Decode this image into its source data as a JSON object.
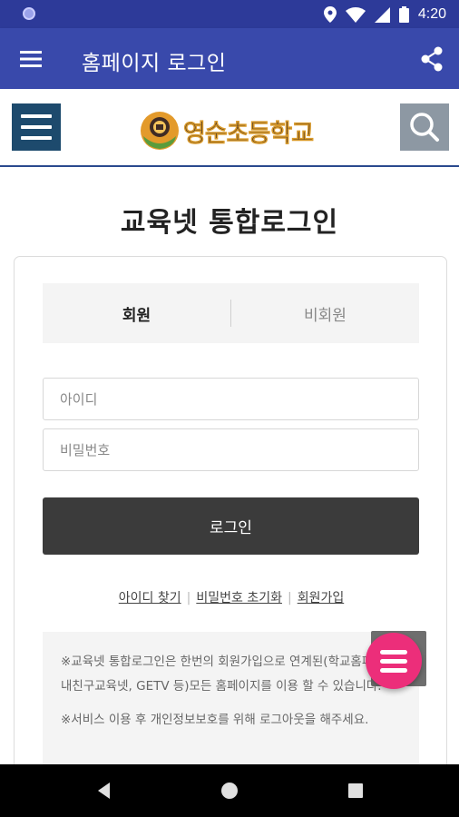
{
  "status_bar": {
    "time": "4:20",
    "icons": [
      "location-icon",
      "wifi-icon",
      "signal-icon",
      "battery-icon"
    ]
  },
  "app_bar": {
    "title": "홈페이지 로그인",
    "menu_icon": "hamburger-menu-icon",
    "share_icon": "share-icon",
    "color": "#3949ab"
  },
  "site_header": {
    "logo_text": "영순초등학교",
    "menu_icon": "hamburger-menu-icon",
    "search_icon": "search-icon"
  },
  "page": {
    "title": "교육넷 통합로그인"
  },
  "login": {
    "tabs": [
      {
        "label": "회원",
        "active": true
      },
      {
        "label": "비회원",
        "active": false
      }
    ],
    "id_placeholder": "아이디",
    "password_placeholder": "비밀번호",
    "submit_label": "로그인",
    "links": [
      {
        "label": "아이디 찾기"
      },
      {
        "label": "비밀번호 초기화"
      },
      {
        "label": "회원가입"
      }
    ],
    "link_separator": "|",
    "notice": [
      "※교육넷 통합로그인은 한번의 회원가입으로 연계된(학교홈페이지, 내친구교육넷, GETV 등)모든 홈페이지를 이용 할 수 있습니다.",
      "※서비스 이용 후 개인정보보호를 위해 로그아웃을 해주세요."
    ]
  },
  "fab": {
    "icon": "menu-icon",
    "color": "#ec2e7a"
  },
  "nav_bar": {
    "buttons": [
      "back-icon",
      "home-icon",
      "recents-icon"
    ]
  }
}
